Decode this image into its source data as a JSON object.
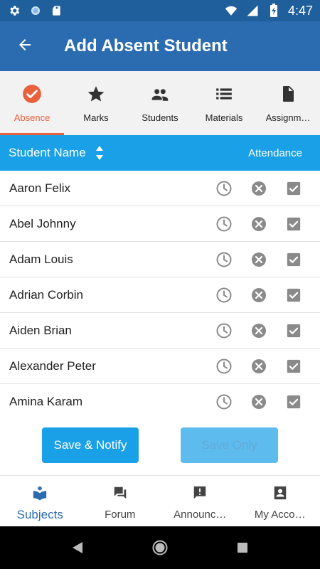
{
  "status_bar": {
    "time": "4:47",
    "icons": [
      "settings-icon",
      "sync-icon",
      "sd-card-icon",
      "wifi-icon",
      "signal-icon",
      "battery-charging-icon"
    ]
  },
  "app_bar": {
    "title": "Add Absent Student",
    "back_icon": "arrow-back-icon"
  },
  "tabs": [
    {
      "label": "Absence",
      "icon": "check-circle-icon",
      "active": true
    },
    {
      "label": "Marks",
      "icon": "star-icon",
      "active": false
    },
    {
      "label": "Students",
      "icon": "people-icon",
      "active": false
    },
    {
      "label": "Materials",
      "icon": "list-icon",
      "active": false
    },
    {
      "label": "Assignm…",
      "icon": "document-icon",
      "active": false
    }
  ],
  "table": {
    "header_name": "Student Name",
    "header_attendance": "Attendance",
    "rows": [
      {
        "name": "Aaron Felix"
      },
      {
        "name": "Abel Johnny"
      },
      {
        "name": "Adam Louis"
      },
      {
        "name": "Adrian Corbin"
      },
      {
        "name": "Aiden Brian"
      },
      {
        "name": "Alexander Peter"
      },
      {
        "name": "Amina Karam"
      }
    ]
  },
  "buttons": {
    "save_notify": "Save & Notify",
    "save_only": "Save Only"
  },
  "bottom_nav": [
    {
      "label": "Subjects",
      "icon": "book-icon",
      "active": true
    },
    {
      "label": "Forum",
      "icon": "forum-icon",
      "active": false
    },
    {
      "label": "Announc…",
      "icon": "announcement-icon",
      "active": false
    },
    {
      "label": "My Acco…",
      "icon": "account-box-icon",
      "active": false
    }
  ],
  "colors": {
    "status_bar": "#1f5f9b",
    "app_bar": "#2b6cb0",
    "accent": "#e8603c",
    "table_header": "#1aa0e6",
    "active_nav": "#2b6cb0"
  }
}
